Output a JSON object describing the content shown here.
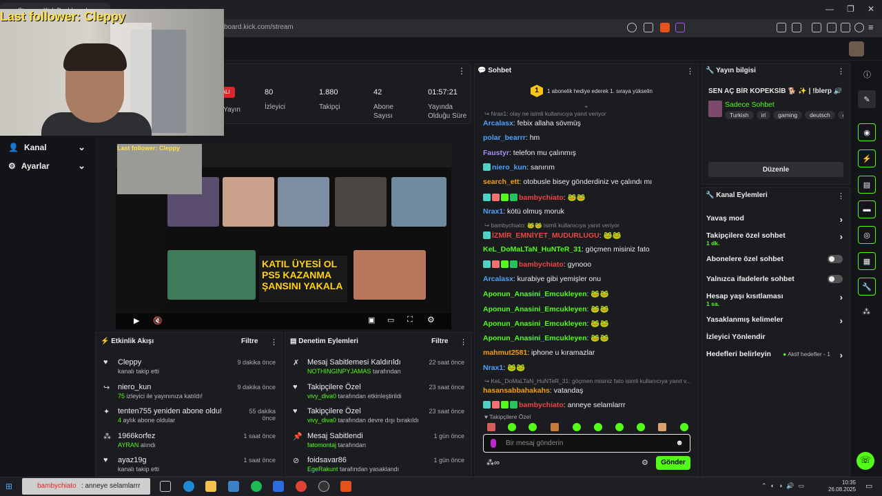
{
  "browser": {
    "tab_title": "Stream - Kick Dashboard",
    "url": "board.kick.com/stream"
  },
  "overlay": {
    "last_follower": "Last follower: Cleppy"
  },
  "nav": {
    "items": [
      {
        "label": "Kanal"
      },
      {
        "label": "Ayarlar"
      }
    ]
  },
  "stats": {
    "live_badge": "PALI",
    "live_label": "u Yayın",
    "viewers_value": "80",
    "viewers_label": "İzleyici",
    "followers_value": "1.880",
    "followers_label": "Takipçi",
    "subs_value": "42",
    "subs_label": "Abone Sayısı",
    "uptime_value": "01:57:21",
    "uptime_label": "Yayında Olduğu Süre"
  },
  "preview": {
    "overlay_text": "Last follower: Cleppy",
    "thumb_text": "KATIL ÜYESİ OL PS5 KAZANMA ŞANSINI YAKALA"
  },
  "activity": {
    "title": "Etkinlik Akışı",
    "filter": "Filtre",
    "items": [
      {
        "name": "Cleppy",
        "sub": "kanalı takip etti",
        "time": "9 dakika önce"
      },
      {
        "name": "niero_kun",
        "sub_green": "75",
        "sub": " izleyici ile yayınınıza katıldı!",
        "time": "9 dakika önce"
      },
      {
        "name": "tenten755 yeniden abone oldu!",
        "sub_green": "4",
        "sub": " aylık abone oldular",
        "time": "55 dakika önce"
      },
      {
        "name": "1966korfez",
        "sub_green": "AYRAN",
        "sub": " alındı",
        "time": "1 saat önce"
      },
      {
        "name": "ayaz19g",
        "sub": "kanalı takip etti",
        "time": "1 saat önce"
      }
    ]
  },
  "moderation": {
    "title": "Denetim Eylemleri",
    "filter": "Filtre",
    "items": [
      {
        "name": "Mesaj Sabitlemesi Kaldırıldı",
        "sub_green": "NOTHINGINPYJAMAS",
        "sub": " tarafından",
        "time": "22 saat önce"
      },
      {
        "name": "Takipçilere Özel",
        "sub_green": "vivy_diva0",
        "sub": " tarafından etkinleştirildi",
        "time": "23 saat önce"
      },
      {
        "name": "Takipçilere Özel",
        "sub_green": "vivy_diva0",
        "sub": " tarafından devre dışı bırakıldı",
        "time": "23 saat önce"
      },
      {
        "name": "Mesaj Sabitlendi",
        "sub_green": "fatomontaj",
        "sub": " tarafından",
        "time": "1 gün önce"
      },
      {
        "name": "foidsavar86",
        "sub_green": "EgeRakunt",
        "sub": " tarafından yasaklandı",
        "time": "1 gün önce"
      }
    ]
  },
  "chat": {
    "title": "Sohbet",
    "gift_rank": "1",
    "gift_text": "1 abonelik hediye ederek 1. sıraya yükselin",
    "messages": [
      {
        "type": "reply",
        "text": "Nrax1: olay ne isimli kullanıcıya yanıt veriyor"
      },
      {
        "user": "Arcalasx",
        "color": "#4da3ff",
        "text": "febix allaha sövmüş"
      },
      {
        "user": "polar_bearrr",
        "color": "#4da3ff",
        "text": "hm"
      },
      {
        "user": "Faustyr",
        "color": "#a78bfa",
        "text": "telefon mu çalınmış"
      },
      {
        "user": "niero_kun",
        "color": "#4da3ff",
        "badges": 1,
        "text": "sanırım"
      },
      {
        "user": "search_ett",
        "color": "#f59e0b",
        "text": "otobusle bisey gönderdiniz ve çalındı mı"
      },
      {
        "user": "bambychiato",
        "color": "#ef4444",
        "badges": 4,
        "text": "🐸🐸"
      },
      {
        "user": "Nrax1",
        "color": "#4da3ff",
        "text": "kötü olmuş moruk"
      },
      {
        "type": "reply",
        "text": "bambychiato: 🐸🐸 isimli kullanıcıya yanıt veriyor"
      },
      {
        "user": "İZMİR_EMNİYET_MUDURLUGU",
        "color": "#ef4444",
        "badges": 1,
        "text": "🐸🐸"
      },
      {
        "user": "KeL_DoMaLTaN_HuNTeR_31",
        "color": "#53fc18",
        "text": "göçmen misiniz fato"
      },
      {
        "user": "bambychiato",
        "color": "#ef4444",
        "badges": 4,
        "text": "gynooo"
      },
      {
        "user": "Arcalasx",
        "color": "#4da3ff",
        "text": "kurabiye gibi yemişler onu"
      },
      {
        "user": "Aponun_Anasini_Emcukleyen",
        "color": "#53fc18",
        "text": "🐸🐸"
      },
      {
        "user": "Aponun_Anasini_Emcukleyen",
        "color": "#53fc18",
        "text": "🐸🐸"
      },
      {
        "user": "Aponun_Anasini_Emcukleyen",
        "color": "#53fc18",
        "text": "🐸🐸"
      },
      {
        "user": "Aponun_Anasini_Emcukleyen",
        "color": "#53fc18",
        "text": "🐸🐸"
      },
      {
        "user": "mahmut2581",
        "color": "#f59e0b",
        "text": "iphone u kıramazlar"
      },
      {
        "user": "Nrax1",
        "color": "#4da3ff",
        "text": "🐸🐸"
      },
      {
        "type": "reply",
        "text": "KeL_DoMaLTaN_HuNTeR_31: göçmen misiniz fato isimli kullanıcıya yanıt v..."
      },
      {
        "user": "hasansabbahakahs",
        "color": "#f59e0b",
        "text": "vatandaş"
      },
      {
        "user": "bambychiato",
        "color": "#ef4444",
        "badges": 4,
        "text": "anneye selamlarrr"
      }
    ],
    "followers_only_label": "Takipçilere Özel",
    "input_placeholder": "Bir mesaj gönderin",
    "send_label": "Gönder"
  },
  "stream_info": {
    "title": "Yayın bilgisi",
    "stream_title": "SEN AÇ BİR KÖPEKSİB 🐕 ✨ | !blerp 🔊",
    "category": "Sadece Sohbet",
    "tags": [
      "Turkish",
      "irl",
      "gaming",
      "deutsch",
      "ge"
    ],
    "edit_label": "Düzenle"
  },
  "channel_actions": {
    "title": "Kanal Eylemleri",
    "items": [
      {
        "label": "Yavaş mod",
        "kind": "arrow"
      },
      {
        "label": "Takipçilere özel sohbet",
        "sub": "1 dk.",
        "kind": "arrow"
      },
      {
        "label": "Abonelere özel sohbet",
        "kind": "toggle"
      },
      {
        "label": "Yalnızca ifadelerle sohbet",
        "kind": "toggle"
      },
      {
        "label": "Hesap yaşı kısıtlaması",
        "sub": "1 sa.",
        "kind": "arrow"
      },
      {
        "label": "Yasaklanmış kelimeler",
        "kind": "arrow"
      },
      {
        "label": "İzleyici Yönlendir",
        "kind": "none"
      },
      {
        "label": "Hedefleri belirleyin",
        "extra": "Aktif hedefler - 1",
        "kind": "arrow"
      }
    ]
  },
  "taskbar": {
    "toast_user": "bambychiato",
    "toast_text": ": anneye selamlarrr",
    "time": "10:35",
    "date": "26.08.2025"
  },
  "colors": {
    "accent": "#53fc18",
    "live": "#e0242c"
  }
}
